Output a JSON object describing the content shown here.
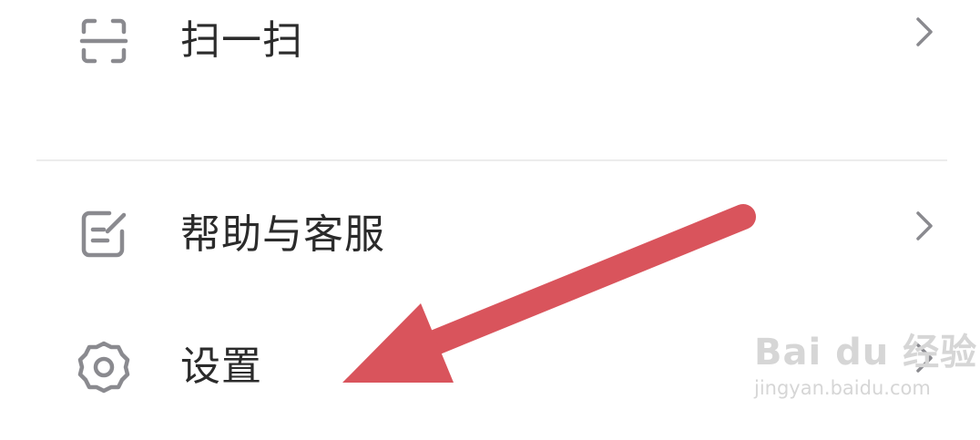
{
  "menu": {
    "items": [
      {
        "label": "扫一扫",
        "icon": "scan-icon"
      },
      {
        "label": "帮助与客服",
        "icon": "help-edit-icon"
      },
      {
        "label": "设置",
        "icon": "gear-icon"
      }
    ]
  },
  "annotation": {
    "arrow_color": "#d9545c"
  },
  "watermark": {
    "brand": "Bai du 经验",
    "url": "jingyan.baidu.com"
  },
  "colors": {
    "text": "#2b2b2b",
    "icon": "#8a8a8f",
    "divider": "#ececec"
  }
}
